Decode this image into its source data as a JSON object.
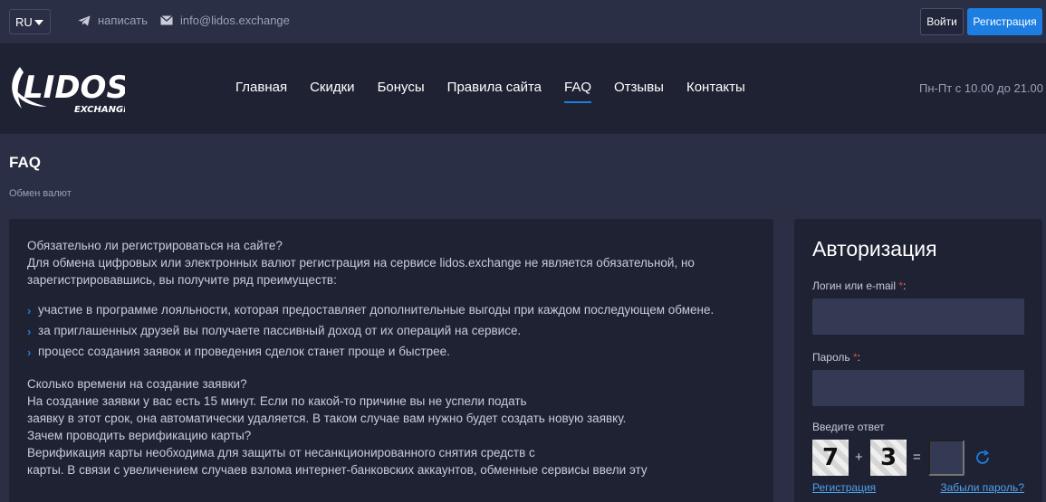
{
  "topbar": {
    "lang": "RU",
    "telegram_label": "написать",
    "email_label": "info@lidos.exchange",
    "login_label": "Войти",
    "register_label": "Регистрация"
  },
  "header": {
    "logo_text": "LIDOS",
    "logo_sub": "EXCHANGE",
    "nav": [
      "Главная",
      "Скидки",
      "Бонусы",
      "Правила сайта",
      "FAQ",
      "Отзывы",
      "Контакты"
    ],
    "active_nav": "FAQ",
    "hours": "Пн-Пт с 10.00 до 21.00"
  },
  "page": {
    "title": "FAQ",
    "breadcrumb": "Обмен валют"
  },
  "faq": {
    "q1": "Обязательно ли регистрироваться на сайте?",
    "a1_line1": "Для обмена цифровых или электронных валют регистрация на сервисе lidos.exchange не является обязательной, но",
    "a1_line2": "зарегистрировавшись, вы получите ряд преимуществ:",
    "benefits": [
      "участие в программе лояльности, которая предоставляет дополнительные выгоды при каждом последующем обмене.",
      "за приглашенных друзей вы получаете пассивный доход от их операций на сервисе.",
      "процесс создания заявок и проведения сделок станет проще и быстрее."
    ],
    "q2": "Сколько времени на создание заявки?",
    "a2_line1": "На создание заявки у вас есть 15 минут. Если по какой-то причине вы не успели подать",
    "a2_line2": "заявку в этот срок, она автоматически удаляется. В таком случае вам нужно будет создать новую заявку.",
    "q3": "Зачем проводить верификацию карты?",
    "a3_line1": "Верификация карты необходима для защиты от несанкционированного снятия средств с",
    "a3_line2": "карты. В связи с увеличением случаев взлома интернет-банковских аккаунтов, обменные сервисы ввели эту"
  },
  "auth": {
    "title": "Авторизация",
    "login_label": "Логин или e-mail",
    "password_label": "Пароль",
    "required_mark": "*",
    "colon": ":",
    "captcha_label": "Введите ответ",
    "captcha_a": "7",
    "captcha_op": "+",
    "captcha_b": "3",
    "captcha_eq": "=",
    "register_link": "Регистрация",
    "forgot_link": "Забыли пароль?"
  },
  "colors": {
    "accent": "#1d7ee2",
    "bg": "#2b2f45",
    "panel": "#1f2233",
    "required": "#e0404a"
  }
}
